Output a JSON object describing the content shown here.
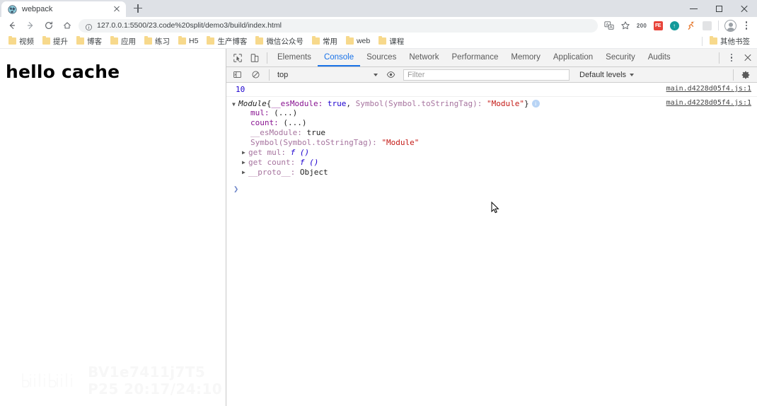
{
  "window": {
    "controls": {
      "minimize": "minimize-icon",
      "maximize": "maximize-icon",
      "close": "close-icon"
    }
  },
  "tabstrip": {
    "tabs": [
      {
        "title": "webpack",
        "favicon": "webpack-globe-icon",
        "active": true
      }
    ],
    "new_tab_label": "+"
  },
  "toolbar": {
    "back": "back-arrow-icon",
    "forward": "forward-arrow-icon",
    "reload": "reload-icon",
    "home": "home-icon",
    "omnibox": {
      "url": "127.0.0.1:5500/23.code%20split/demo3/build/index.html",
      "info_icon": "page-info-icon"
    },
    "right_icons": [
      {
        "name": "translate-icon",
        "label": ""
      },
      {
        "name": "bookmark-star-icon",
        "label": ""
      },
      {
        "name": "counter-badge",
        "label": "200"
      },
      {
        "name": "extension-fe-icon",
        "label": "FE"
      },
      {
        "name": "extension-teal-icon",
        "label": "↑"
      },
      {
        "name": "extension-runner-icon",
        "label": ""
      },
      {
        "name": "extension-grey-icon",
        "label": ""
      }
    ],
    "profile": "profile-avatar",
    "menu": "chrome-menu-icon"
  },
  "bookmarks": {
    "items": [
      {
        "label": "视频"
      },
      {
        "label": "提升"
      },
      {
        "label": "博客"
      },
      {
        "label": "应用"
      },
      {
        "label": "练习"
      },
      {
        "label": "H5"
      },
      {
        "label": "生产博客"
      },
      {
        "label": "微信公众号"
      },
      {
        "label": "常用"
      },
      {
        "label": "web"
      },
      {
        "label": "课程"
      }
    ],
    "other": {
      "label": "其他书签"
    }
  },
  "page": {
    "heading": "hello cache",
    "watermark": {
      "brand": "bilibili",
      "text": "BV1e7411j7T5 P25 20:17/24:10"
    }
  },
  "devtools": {
    "inspect_icon": "inspect-element-icon",
    "device_icon": "device-toolbar-icon",
    "tabs": [
      {
        "label": "Elements",
        "active": false
      },
      {
        "label": "Console",
        "active": true
      },
      {
        "label": "Sources",
        "active": false
      },
      {
        "label": "Network",
        "active": false
      },
      {
        "label": "Performance",
        "active": false
      },
      {
        "label": "Memory",
        "active": false
      },
      {
        "label": "Application",
        "active": false
      },
      {
        "label": "Security",
        "active": false
      },
      {
        "label": "Audits",
        "active": false
      }
    ],
    "more_icon": "devtools-more-icon",
    "close_icon": "devtools-close-icon",
    "filterbar": {
      "sidebar_toggle": "console-sidebar-icon",
      "clear_console": "clear-console-icon",
      "context": "top",
      "eye_icon": "live-expression-icon",
      "filter_placeholder": "Filter",
      "filter_value": "",
      "levels": "Default levels",
      "settings": "settings-gear-icon"
    },
    "console": {
      "entries": [
        {
          "type": "value",
          "value": "10",
          "source": "main.d4228d05f4.js:1"
        },
        {
          "type": "object",
          "source": "main.d4228d05f4.js:1",
          "header": {
            "classname": "Module",
            "open_brace": "{",
            "prop1": "__esModule:",
            "val1": "true",
            "sep": ",",
            "prop2": "Symbol(Symbol.toStringTag):",
            "val2": "\"Module\"",
            "close_brace": "}"
          },
          "props": [
            {
              "key": "mul:",
              "value": "(...)",
              "style": "lazy"
            },
            {
              "key": "count:",
              "value": "(...)",
              "style": "lazy"
            },
            {
              "key": "__esModule:",
              "value": "true",
              "style": "bool"
            },
            {
              "key": "Symbol(Symbol.toStringTag):",
              "value": "\"Module\"",
              "style": "string"
            }
          ],
          "getters": [
            {
              "key": "get mul:",
              "value": "f ()"
            },
            {
              "key": "get count:",
              "value": "f ()"
            },
            {
              "key": "__proto__:",
              "value": "Object"
            }
          ]
        }
      ],
      "prompt": "❯"
    }
  }
}
